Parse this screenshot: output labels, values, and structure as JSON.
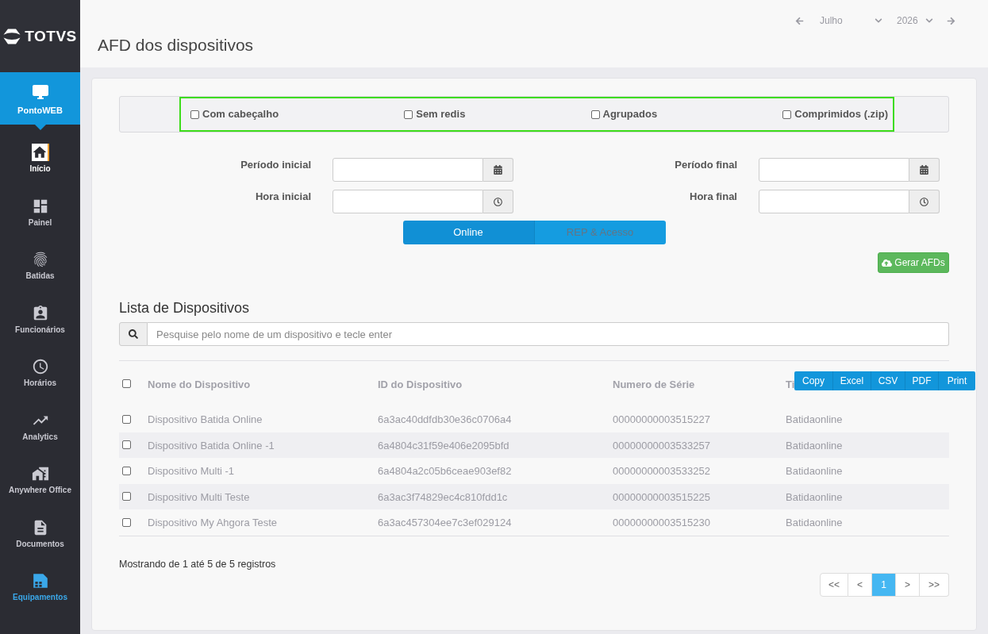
{
  "sidebar": {
    "logo": {
      "text": "TOTVS"
    },
    "module": {
      "label": "PontoWEB",
      "selected": true
    },
    "items": [
      {
        "label": "Início",
        "selected": false,
        "hovered": true
      },
      {
        "label": "Painel",
        "selected": false,
        "hovered": false
      },
      {
        "label": "Batidas",
        "selected": false,
        "hovered": false
      },
      {
        "label": "Funcionários",
        "selected": false,
        "hovered": false
      },
      {
        "label": "Horários",
        "selected": false,
        "hovered": false
      },
      {
        "label": "Analytics",
        "selected": false,
        "hovered": false
      },
      {
        "label": "Anywhere Office",
        "selected": false,
        "hovered": false
      },
      {
        "label": "Documentos",
        "selected": false,
        "hovered": false
      },
      {
        "label": "Equipamentos",
        "selected": true,
        "hovered": false
      }
    ]
  },
  "header": {
    "title": "AFD dos dispositivos",
    "month": "Julho",
    "year": "2026"
  },
  "options": {
    "highlighted": true,
    "items": [
      {
        "label": "Com cabeçalho",
        "checked": false
      },
      {
        "label": "Sem redis",
        "checked": false
      },
      {
        "label": "Agrupados",
        "checked": false
      },
      {
        "label": "Comprimidos (.zip)",
        "checked": false
      }
    ]
  },
  "filters": [
    {
      "label": "Período inicial",
      "kind": "date"
    },
    {
      "label": "Período final",
      "kind": "date"
    },
    {
      "label": "Hora inicial",
      "kind": "time"
    },
    {
      "label": "Hora final",
      "kind": "time"
    }
  ],
  "source_tabs": [
    {
      "label": "Online",
      "selected": true
    },
    {
      "label": "REP & Acesso",
      "selected": false
    }
  ],
  "generate_button": {
    "label": "Gerar AFDs"
  },
  "device_list": {
    "title": "Lista de Dispositivos",
    "search": {
      "placeholder": "Pesquise pelo nome de um dispositivo e tecle enter"
    },
    "export_buttons": [
      "Copy",
      "Excel",
      "CSV",
      "PDF",
      "Print"
    ],
    "table": {
      "select_all": {
        "checked": false
      },
      "columns": [
        "Nome do Dispositivo",
        "ID do Dispositivo",
        "Numero de Série",
        "Ti"
      ],
      "rows": [
        {
          "checked": false,
          "cells": [
            "Dispositivo Batida Online",
            "6a3ac40ddfdb30e36c0706a4",
            "00000000003515227",
            "Batidaonline"
          ]
        },
        {
          "checked": false,
          "cells": [
            "Dispositivo Batida Online -1",
            "6a4804c31f59e406e2095bfd",
            "00000000003533257",
            "Batidaonline"
          ]
        },
        {
          "checked": false,
          "cells": [
            "Dispositivo Multi -1",
            "6a4804a2c05b6ceae903ef82",
            "00000000003533252",
            "Batidaonline"
          ]
        },
        {
          "checked": false,
          "cells": [
            "Dispositivo Multi Teste",
            "6a3ac3f74829ec4c810fdd1c",
            "00000000003515225",
            "Batidaonline"
          ]
        },
        {
          "checked": false,
          "cells": [
            "Dispositivo My Ahgora Teste",
            "6a3ac457304ee7c3ef029124",
            "00000000003515230",
            "Batidaonline"
          ]
        }
      ]
    },
    "summary": "Mostrando de 1 até 5 de 5 registros",
    "pagination": [
      {
        "label": "<<",
        "selected": false
      },
      {
        "label": "<",
        "selected": false
      },
      {
        "label": "1",
        "selected": true
      },
      {
        "label": ">",
        "selected": false
      },
      {
        "label": ">>",
        "selected": false
      }
    ]
  }
}
